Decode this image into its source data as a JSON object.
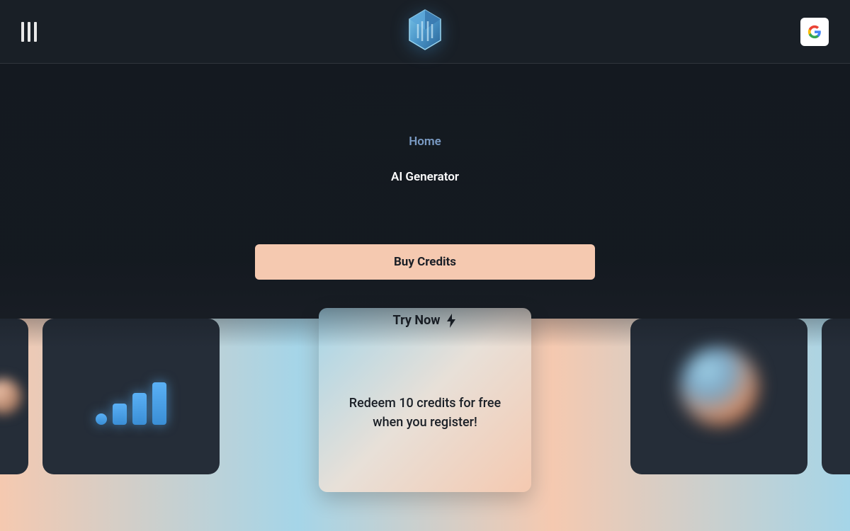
{
  "nav": {
    "home": "Home",
    "ai_generator": "AI Generator"
  },
  "buttons": {
    "buy_credits": "Buy Credits",
    "try_now": "Try Now"
  },
  "promo": {
    "redeem_text": "Redeem 10 credits for free when you register!"
  },
  "icons": {
    "menu": "menu-icon",
    "logo": "app-logo",
    "google": "google-icon",
    "lightning": "lightning-icon"
  },
  "colors": {
    "accent_peach": "#f5c9b0",
    "accent_blue": "#a5d5e8",
    "link_blue": "#7a9bc4",
    "bg_dark": "#1a1f26",
    "card_dark": "#252d38"
  }
}
